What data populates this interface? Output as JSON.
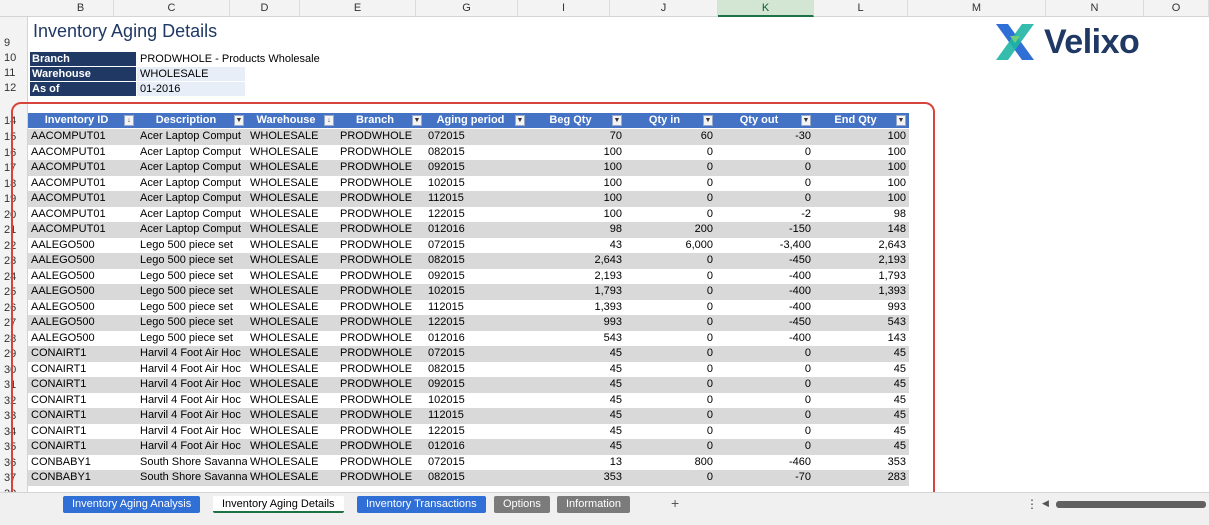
{
  "column_headers": [
    "B",
    "C",
    "D",
    "E",
    "G",
    "I",
    "J",
    "K",
    "L",
    "M",
    "N",
    "O"
  ],
  "selected_column": "K",
  "report": {
    "title": "Inventory Aging Details",
    "fields": [
      {
        "label": "Branch",
        "value": "PRODWHOLE - Products Wholesale"
      },
      {
        "label": "Warehouse",
        "value": "WHOLESALE"
      },
      {
        "label": "As of",
        "value": "01-2016"
      }
    ]
  },
  "logo": {
    "text": "Velixo",
    "color_primary": "#1f3864",
    "color_accent": "#2f6fd6"
  },
  "row_numbers": [
    "9",
    "10",
    "11",
    "12",
    "14",
    "15",
    "16",
    "17",
    "18",
    "19",
    "20",
    "21",
    "22",
    "23",
    "24",
    "25",
    "26",
    "27",
    "28",
    "29",
    "30",
    "31",
    "32",
    "33",
    "34",
    "35",
    "36",
    "37",
    "38"
  ],
  "table": {
    "columns": [
      "Inventory ID",
      "Description",
      "Warehouse",
      "Branch",
      "Aging period",
      "Beg Qty",
      "Qty in",
      "Qty out",
      "End Qty"
    ],
    "rows": [
      [
        "AACOMPUT01",
        "Acer Laptop Comput",
        "WHOLESALE",
        "PRODWHOLE",
        "072015",
        "70",
        "60",
        "-30",
        "100"
      ],
      [
        "AACOMPUT01",
        "Acer Laptop Comput",
        "WHOLESALE",
        "PRODWHOLE",
        "082015",
        "100",
        "0",
        "0",
        "100"
      ],
      [
        "AACOMPUT01",
        "Acer Laptop Comput",
        "WHOLESALE",
        "PRODWHOLE",
        "092015",
        "100",
        "0",
        "0",
        "100"
      ],
      [
        "AACOMPUT01",
        "Acer Laptop Comput",
        "WHOLESALE",
        "PRODWHOLE",
        "102015",
        "100",
        "0",
        "0",
        "100"
      ],
      [
        "AACOMPUT01",
        "Acer Laptop Comput",
        "WHOLESALE",
        "PRODWHOLE",
        "112015",
        "100",
        "0",
        "0",
        "100"
      ],
      [
        "AACOMPUT01",
        "Acer Laptop Comput",
        "WHOLESALE",
        "PRODWHOLE",
        "122015",
        "100",
        "0",
        "-2",
        "98"
      ],
      [
        "AACOMPUT01",
        "Acer Laptop Comput",
        "WHOLESALE",
        "PRODWHOLE",
        "012016",
        "98",
        "200",
        "-150",
        "148"
      ],
      [
        "AALEGO500",
        "Lego 500 piece set",
        "WHOLESALE",
        "PRODWHOLE",
        "072015",
        "43",
        "6,000",
        "-3,400",
        "2,643"
      ],
      [
        "AALEGO500",
        "Lego 500 piece set",
        "WHOLESALE",
        "PRODWHOLE",
        "082015",
        "2,643",
        "0",
        "-450",
        "2,193"
      ],
      [
        "AALEGO500",
        "Lego 500 piece set",
        "WHOLESALE",
        "PRODWHOLE",
        "092015",
        "2,193",
        "0",
        "-400",
        "1,793"
      ],
      [
        "AALEGO500",
        "Lego 500 piece set",
        "WHOLESALE",
        "PRODWHOLE",
        "102015",
        "1,793",
        "0",
        "-400",
        "1,393"
      ],
      [
        "AALEGO500",
        "Lego 500 piece set",
        "WHOLESALE",
        "PRODWHOLE",
        "112015",
        "1,393",
        "0",
        "-400",
        "993"
      ],
      [
        "AALEGO500",
        "Lego 500 piece set",
        "WHOLESALE",
        "PRODWHOLE",
        "122015",
        "993",
        "0",
        "-450",
        "543"
      ],
      [
        "AALEGO500",
        "Lego 500 piece set",
        "WHOLESALE",
        "PRODWHOLE",
        "012016",
        "543",
        "0",
        "-400",
        "143"
      ],
      [
        "CONAIRT1",
        "Harvil 4 Foot Air Hoc",
        "WHOLESALE",
        "PRODWHOLE",
        "072015",
        "45",
        "0",
        "0",
        "45"
      ],
      [
        "CONAIRT1",
        "Harvil 4 Foot Air Hoc",
        "WHOLESALE",
        "PRODWHOLE",
        "082015",
        "45",
        "0",
        "0",
        "45"
      ],
      [
        "CONAIRT1",
        "Harvil 4 Foot Air Hoc",
        "WHOLESALE",
        "PRODWHOLE",
        "092015",
        "45",
        "0",
        "0",
        "45"
      ],
      [
        "CONAIRT1",
        "Harvil 4 Foot Air Hoc",
        "WHOLESALE",
        "PRODWHOLE",
        "102015",
        "45",
        "0",
        "0",
        "45"
      ],
      [
        "CONAIRT1",
        "Harvil 4 Foot Air Hoc",
        "WHOLESALE",
        "PRODWHOLE",
        "112015",
        "45",
        "0",
        "0",
        "45"
      ],
      [
        "CONAIRT1",
        "Harvil 4 Foot Air Hoc",
        "WHOLESALE",
        "PRODWHOLE",
        "122015",
        "45",
        "0",
        "0",
        "45"
      ],
      [
        "CONAIRT1",
        "Harvil 4 Foot Air Hoc",
        "WHOLESALE",
        "PRODWHOLE",
        "012016",
        "45",
        "0",
        "0",
        "45"
      ],
      [
        "CONBABY1",
        "South Shore Savanna",
        "WHOLESALE",
        "PRODWHOLE",
        "072015",
        "13",
        "800",
        "-460",
        "353"
      ],
      [
        "CONBABY1",
        "South Shore Savanna",
        "WHOLESALE",
        "PRODWHOLE",
        "082015",
        "353",
        "0",
        "-70",
        "283"
      ]
    ]
  },
  "sheet_tabs": [
    {
      "label": "Inventory Aging Analysis",
      "style": "blue"
    },
    {
      "label": "Inventory Aging Details",
      "style": "active"
    },
    {
      "label": "Inventory Transactions",
      "style": "blue"
    },
    {
      "label": "Options",
      "style": "gray"
    },
    {
      "label": "Information",
      "style": "gray"
    }
  ],
  "add_sheet_label": "+",
  "colors": {
    "header_blue": "#4472c4",
    "label_navy": "#1f3864",
    "highlight_red": "#d6443c",
    "stripe_gray": "#d9d9d9"
  }
}
